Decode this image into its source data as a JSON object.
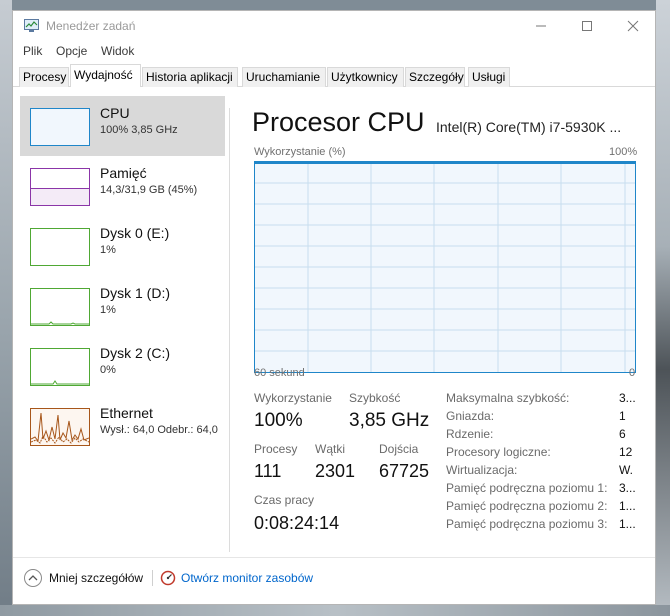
{
  "window": {
    "title": "Menedżer zadań"
  },
  "menu": [
    "Plik",
    "Opcje",
    "Widok"
  ],
  "tabs": [
    "Procesy",
    "Wydajność",
    "Historia aplikacji",
    "Uruchamianie",
    "Użytkownicy",
    "Szczegóły",
    "Usługi"
  ],
  "active_tab": "Wydajność",
  "sidebar": {
    "items": [
      {
        "title": "CPU",
        "subtitle": "100% 3,85 GHz",
        "color": "#1f86c9",
        "active": true
      },
      {
        "title": "Pamięć",
        "subtitle": "14,3/31,9 GB (45%)",
        "color": "#8b35a8"
      },
      {
        "title": "Dysk 0 (E:)",
        "subtitle": "1%",
        "color": "#4fa834"
      },
      {
        "title": "Dysk 1 (D:)",
        "subtitle": "1%",
        "color": "#4fa834"
      },
      {
        "title": "Dysk 2 (C:)",
        "subtitle": "0%",
        "color": "#4fa834"
      },
      {
        "title": "Ethernet",
        "subtitle": "Wysł.: 64,0  Odebr.: 64,0",
        "color": "#a7561a"
      }
    ]
  },
  "main": {
    "title": "Procesor CPU",
    "model": "Intel(R) Core(TM) i7-5930K ...",
    "graph": {
      "label": "Wykorzystanie (%)",
      "max_label": "100%",
      "time_label": "60 sekund",
      "min_label": "0",
      "usage_percent": 100
    },
    "stats": {
      "utilization_label": "Wykorzystanie",
      "utilization": "100%",
      "speed_label": "Szybkość",
      "speed": "3,85 GHz",
      "processes_label": "Procesy",
      "processes": "111",
      "threads_label": "Wątki",
      "threads": "2301",
      "handles_label": "Dojścia",
      "handles": "67725",
      "uptime_label": "Czas pracy",
      "uptime": "0:08:24:14"
    },
    "details": [
      {
        "key": "Maksymalna szybkość:",
        "value": "3..."
      },
      {
        "key": "Gniazda:",
        "value": "1"
      },
      {
        "key": "Rdzenie:",
        "value": "6"
      },
      {
        "key": "Procesory logiczne:",
        "value": "12"
      },
      {
        "key": "Wirtualizacja:",
        "value": "W."
      },
      {
        "key": "Pamięć podręczna poziomu 1:",
        "value": "3..."
      },
      {
        "key": "Pamięć podręczna poziomu 2:",
        "value": "1..."
      },
      {
        "key": "Pamięć podręczna poziomu 3:",
        "value": "1..."
      }
    ]
  },
  "footer": {
    "fewer_details": "Mniej szczegółów",
    "open_monitor": "Otwórz monitor zasobów",
    "link_color": "#0066cc"
  }
}
